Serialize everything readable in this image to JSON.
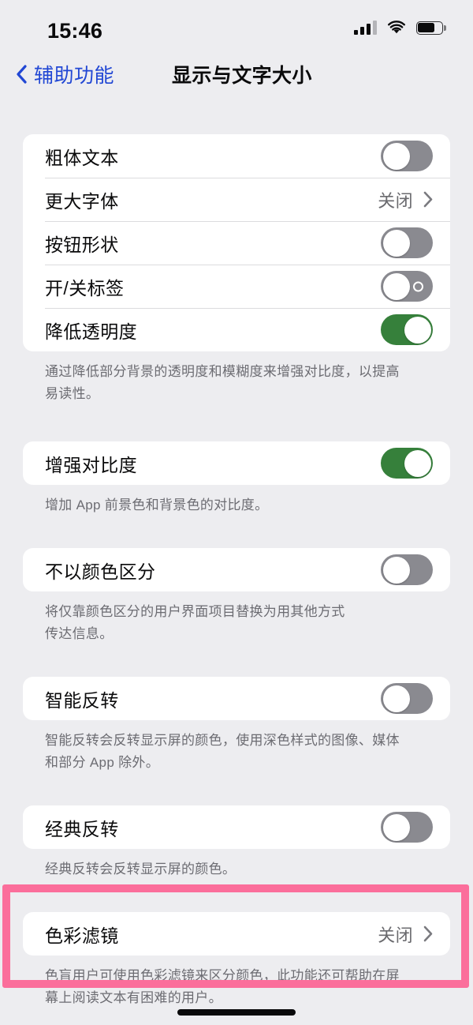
{
  "status_bar": {
    "time": "15:46",
    "signal_icon": "cellular-signal-icon",
    "wifi_icon": "wifi-icon",
    "battery_icon": "battery-icon"
  },
  "nav": {
    "back_icon": "chevron-left-icon",
    "back_label": "辅助功能",
    "title": "显示与文字大小"
  },
  "sections": [
    {
      "rows": [
        {
          "label": "粗体文本",
          "control": "toggle",
          "value": "off"
        },
        {
          "label": "更大字体",
          "control": "disclosure",
          "value": "关闭"
        },
        {
          "label": "按钮形状",
          "control": "toggle",
          "value": "off"
        },
        {
          "label": "开/关标签",
          "control": "toggle-labels",
          "value": "off"
        },
        {
          "label": "降低透明度",
          "control": "toggle",
          "value": "on"
        }
      ],
      "footnote": "通过降低部分背景的透明度和模糊度来增强对比度，以提高\n易读性。"
    },
    {
      "rows": [
        {
          "label": "增强对比度",
          "control": "toggle",
          "value": "on"
        }
      ],
      "footnote": "增加 App 前景色和背景色的对比度。"
    },
    {
      "rows": [
        {
          "label": "不以颜色区分",
          "control": "toggle",
          "value": "off"
        }
      ],
      "footnote": "将仅靠颜色区分的用户界面项目替换为用其他方式\n传达信息。"
    },
    {
      "rows": [
        {
          "label": "智能反转",
          "control": "toggle",
          "value": "off"
        }
      ],
      "footnote": "智能反转会反转显示屏的颜色，使用深色样式的图像、媒体\n和部分 App 除外。"
    },
    {
      "rows": [
        {
          "label": "经典反转",
          "control": "toggle",
          "value": "off"
        }
      ],
      "footnote": "经典反转会反转显示屏的颜色。"
    },
    {
      "rows": [
        {
          "label": "色彩滤镜",
          "control": "disclosure",
          "value": "关闭"
        }
      ],
      "footnote": "色盲用户可使用色彩滤镜来区分颜色，此功能还可帮助在屏\n幕上阅读文本有困难的用户。"
    }
  ],
  "annotation": {
    "highlight_color": "#FB6E9B",
    "target": "色彩滤镜"
  },
  "colors": {
    "background": "#EDEDF0",
    "card": "#FFFFFF",
    "tint_blue": "#2147D4",
    "toggle_on_green": "#36803B",
    "toggle_off_grey": "#8A8A90",
    "secondary_text": "#6C6C72"
  },
  "home_indicator": "home-indicator"
}
